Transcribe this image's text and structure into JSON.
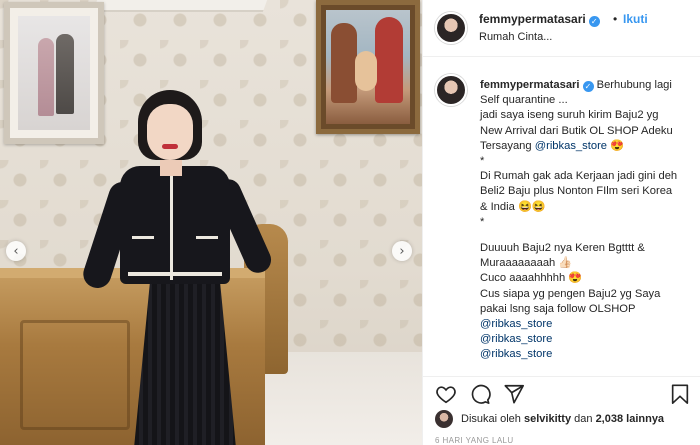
{
  "header": {
    "username": "femmypermatasari",
    "follow_label": "Ikuti",
    "separator": "•",
    "location": "Rumah Cinta...",
    "more_label": "..."
  },
  "caption": {
    "username": "femmypermatasari",
    "first_line": "Berhubung lagi",
    "lines": [
      "Self quarantine ...",
      "jadi saya iseng suruh kirim Baju2 yg",
      "New Arrival dari Butik OL SHOP Adeku",
      "Tersayang ",
      "*",
      "Di Rumah gak ada Kerjaan jadi gini deh",
      "Beli2 Baju plus Nonton FIlm seri Korea",
      "& India 😆😆",
      "*",
      "",
      "Duuuuh Baju2 nya Keren Bgtttt &",
      "Muraaaaaaaah 👍🏻",
      "Cuco aaaahhhhh 😍",
      "Cus siapa yg pengen Baju2 yg Saya",
      "pakai lsng saja follow OLSHOP"
    ],
    "inline_mention": "@ribkas_store",
    "inline_emoji": "😍",
    "mentions": [
      "@ribkas_store",
      "@ribkas_store",
      "@ribkas_store"
    ]
  },
  "actions": {
    "icons": [
      "heart-icon",
      "comment-icon",
      "share-icon",
      "bookmark-icon"
    ]
  },
  "likes": {
    "prefix": "Disukai oleh",
    "user": "selvikitty",
    "conj": "dan",
    "count": "2,038 lainnya"
  },
  "timestamp": "6 HARI YANG LALU",
  "colors": {
    "link_blue": "#3897f0",
    "mention_blue": "#003569",
    "text": "#262626",
    "muted": "#999999",
    "border": "#efefef"
  },
  "photo": {
    "nav_prev": "‹",
    "nav_next": "›"
  }
}
